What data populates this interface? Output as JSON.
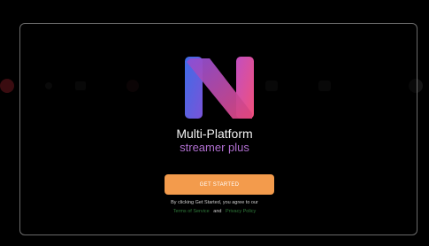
{
  "app": {
    "title": "Multi-Platform",
    "subtitle": "streamer plus",
    "logo_name": "multi-platform-logo"
  },
  "cta": {
    "label": "GET STARTED"
  },
  "legal": {
    "prefix": "By clicking Get Started, you agree to our",
    "terms_label": "Terms of Service",
    "conjunction": "and",
    "privacy_label": "Privacy Policy"
  },
  "colors": {
    "background": "#000000",
    "accent_button": "#f39b4c",
    "subtitle": "#b06fd0",
    "link": "#2f7a3a",
    "logo_gradient_start": "#3e6ce8",
    "logo_gradient_end": "#e0457a"
  }
}
